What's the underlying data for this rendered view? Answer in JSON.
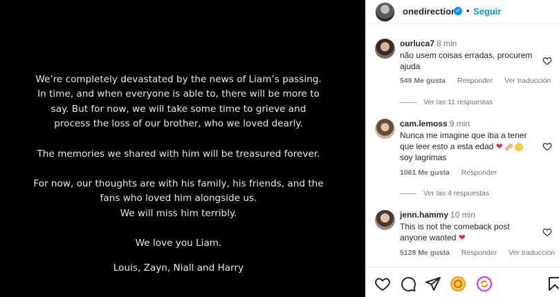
{
  "post": {
    "lines_p1": [
      "We’re completely devastated by the news of Liam’s passing.",
      "In time, and when everyone is able to, there will be more to",
      "say. But for now, we will take some time to grieve and",
      "process the loss of our brother, who we loved dearly."
    ],
    "line_p2": "The memories we shared with him will be treasured forever.",
    "lines_p3": [
      "For now, our thoughts are with his family, his friends, and the",
      "fans who loved him alongside us.",
      "We will miss him terribly."
    ],
    "line_p4": "We love you Liam.",
    "line_p5": "Louis, Zayn, Niall and Harry"
  },
  "header": {
    "username": "onedirection",
    "verified_mark": "✓",
    "separator": "•",
    "follow_label": "Seguir",
    "avatar_icon": "profile-avatar"
  },
  "comments": [
    {
      "user": "ourluca7",
      "time": "8 min",
      "text": "não usem coisas erradas, procurem ajuda",
      "likes": "549 Me gusta",
      "reply": "Responder",
      "translate": "Ver traducción",
      "replies": "Ver las 11 respuestas"
    },
    {
      "user": "cam.lemoss",
      "time": "9 min",
      "text": "Nunca me imagine que iba a tener que leer esto a esta edad",
      "text_line2": "soy lagrimas",
      "likes": "1061 Me gusta",
      "reply": "Responder",
      "replies": "Ver las 4 respuestas"
    },
    {
      "user": "jenn.hammy",
      "time": "10 min",
      "text": "This is not the comeback post anyone wanted",
      "likes": "5128 Me gusta",
      "reply": "Responder",
      "translate": "Ver traducción"
    }
  ],
  "actions": {
    "icons": [
      "heart-icon",
      "comment-icon",
      "share-icon",
      "emoji-sticker-icon",
      "remix-icon",
      "bookmark-icon"
    ]
  },
  "colors": {
    "accent": "#0095f6",
    "heart": "#e0245e",
    "post_bg": "#000000"
  }
}
